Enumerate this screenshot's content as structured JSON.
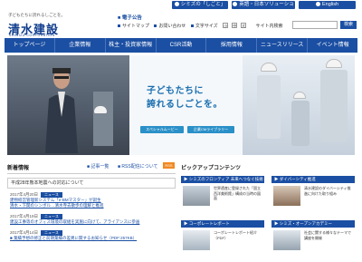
{
  "topbar": {
    "buttons": [
      {
        "label": "シミズの「しごと」"
      },
      {
        "label": "英語・日本ソリューション"
      },
      {
        "label": "English"
      }
    ]
  },
  "header": {
    "tagline": "子どもたちに誇れるしごとを。",
    "logo": "清水建設",
    "logo_en": "SHIMIZU CORPORATION",
    "ad_link": "電子公告",
    "links": [
      "サイトマップ",
      "お問い合わせ",
      "文字サイズ"
    ],
    "font_sizes": [
      "小",
      "中",
      "大"
    ],
    "search_label": "サイト内検索",
    "search_button": "検索",
    "search_placeholder": ""
  },
  "nav": {
    "items": [
      "トップページ",
      "企業情報",
      "株主・投資家情報",
      "CSR活動",
      "採用情報",
      "ニュースリリース",
      "イベント情報"
    ]
  },
  "hero": {
    "line1": "子どもたちに",
    "line2": "誇れるしごとを。",
    "btn1": "スペシャルムービー",
    "btn2": "企業CMライブラリー"
  },
  "news": {
    "title": "新着情報",
    "list_link": "記事一覧",
    "rss_link": "RSS配信について",
    "rss_badge": "RSS",
    "notice": "平成28年熊本地震への対応について",
    "items": [
      {
        "date": "2017年4月20日",
        "badge": "ニュース",
        "text": "建物経営管理新システム「e-BMマスター」が誕生"
      },
      {
        "date": "",
        "badge": "",
        "text": "清水・下関のシンボル…清水寺去散歩の理解と推進"
      },
      {
        "date": "2017年4月19日",
        "badge": "ニュース",
        "text": "建設工事等のオフィス環境の取組を実施に向けて、アライアンスに参画"
      },
      {
        "date": "2017年4月14日",
        "badge": "ニュース",
        "text": "■ 業績予想の修正と前期業績の差異に関するお知らせ（PDF:257KB）"
      }
    ]
  },
  "pickup": {
    "title": "ピックアップコンテンツ",
    "cards": [
      {
        "head": "▶ シミズのフロンティア 未来へつなぐ技術",
        "text": "世界遺産に登録された「国立西洋美術館」構成の当時の図面"
      },
      {
        "head": "▶ ダイバーシティ推進",
        "text": "清水建設のダイバーシティ推進に向けた取り組み"
      },
      {
        "head": "▶ コーポレートレポート",
        "text": "コーポレートレポート紹介（PDF）"
      },
      {
        "head": "▶ シミズ・オープンアカデミー",
        "text": "社会に関する様々なテーマで講座を開催"
      }
    ]
  }
}
